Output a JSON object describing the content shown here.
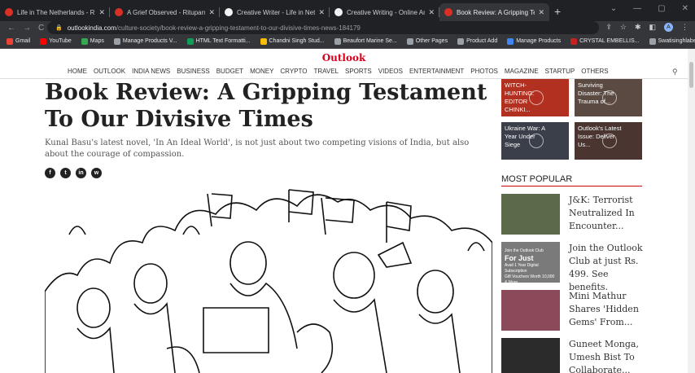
{
  "tabs": [
    {
      "title": "Life in The Netherlands - Rituparna",
      "color": "#d93025"
    },
    {
      "title": "A Grief Observed - Rituparna Roy",
      "color": "#d93025"
    },
    {
      "title": "Creative Writer - Life in Netherlands",
      "color": "#f1f3f4"
    },
    {
      "title": "Creative Writing - Online Articles",
      "color": "#f1f3f4"
    },
    {
      "title": "Book Review: A Gripping Testament",
      "color": "#d93025",
      "active": true
    }
  ],
  "address": {
    "domain": "outlookindia.com",
    "path": "/culture-society/book-review-a-gripping-testament-to-our-divisive-times-news-184179"
  },
  "bookmarks": [
    "Gmail",
    "YouTube",
    "Maps",
    "Manage Products V...",
    "HTML Text Formatti...",
    "Chandni Singh Stud...",
    "Beaufort Marine Se...",
    "Other Pages",
    "Product Add",
    "Manage Products",
    "CRYSTAL EMBELLIS...",
    "Swatisinghlabel.com"
  ],
  "bookmark_colors": [
    "#ea4335",
    "#ff0000",
    "#34a853",
    "#9aa0a6",
    "#0f9d58",
    "#fbbc04",
    "#9aa0a6",
    "#9aa0a6",
    "#9aa0a6",
    "#4285f4",
    "#c5221f",
    "#9aa0a6"
  ],
  "site": {
    "logo": "Outlook",
    "menu": [
      "HOME",
      "OUTLOOK",
      "INDIA NEWS",
      "BUSINESS",
      "BUDGET",
      "MONEY",
      "CRYPTO",
      "TRAVEL",
      "SPORTS",
      "VIDEOS",
      "ENTERTAINMENT",
      "PHOTOS",
      "MAGAZINE",
      "STARTUP",
      "OTHERS"
    ],
    "title": "Book Review: A Gripping Testament To Our Divisive Times",
    "subtitle": "Kunal Basu's latest novel, 'In An Ideal World', is not just about two competing visions of India, but also about the courage of compassion.",
    "share": [
      "f",
      "t",
      "in",
      "w"
    ]
  },
  "tiles": [
    {
      "text": "WITCH-HUNTING: EDITOR CHINKI...",
      "bg": "#b2301f"
    },
    {
      "text": "Surviving Disaster: The Trauma of...",
      "bg": "#5a4a42"
    },
    {
      "text": "Ukraine War: A Year Under Siege",
      "bg": "#3a3f4a"
    },
    {
      "text": "Outlook's Latest Issue: Deliver Us...",
      "bg": "#4a3530"
    }
  ],
  "most_popular": {
    "heading": "MOST POPULAR",
    "items": [
      {
        "text": "J&K: Terrorist Neutralized In Encounter...",
        "color": "#5b6b4a"
      },
      {
        "text": "Join the Outlook Club at just Rs. 499. See benefits.",
        "color": "#8a8a8a"
      },
      {
        "text": "Mini Mathur Shares 'Hidden Gems' From...",
        "color": "#8a4a5a"
      },
      {
        "text": "Guneet Monga, Umesh Bist To Collaborate...",
        "color": "#2b2b2b"
      }
    ],
    "promo": {
      "line1": "Join the Outlook Club",
      "line2": "For Just",
      "line3": "Avail 1 Year Digital Subscription",
      "line4": "Gift Vouchers Worth 10,000 & More"
    }
  }
}
